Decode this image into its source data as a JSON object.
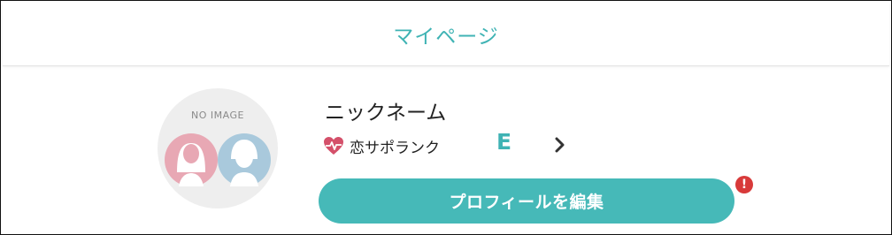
{
  "header": {
    "title": "マイページ"
  },
  "profile": {
    "avatar_text": "NO IMAGE",
    "nickname": "ニックネーム",
    "rank_label": "恋サポランク",
    "rank_value": "E",
    "edit_button_label": "プロフィールを編集",
    "alert_badge": "!"
  },
  "icons": {
    "rank": "heart-pulse-icon",
    "chevron": "chevron-right-icon",
    "avatar_female": "female-silhouette-icon",
    "avatar_male": "male-silhouette-icon"
  },
  "colors": {
    "accent": "#3fb3b4",
    "button": "#46b9b8",
    "heart": "#d4506a",
    "badge": "#d83a3a"
  }
}
